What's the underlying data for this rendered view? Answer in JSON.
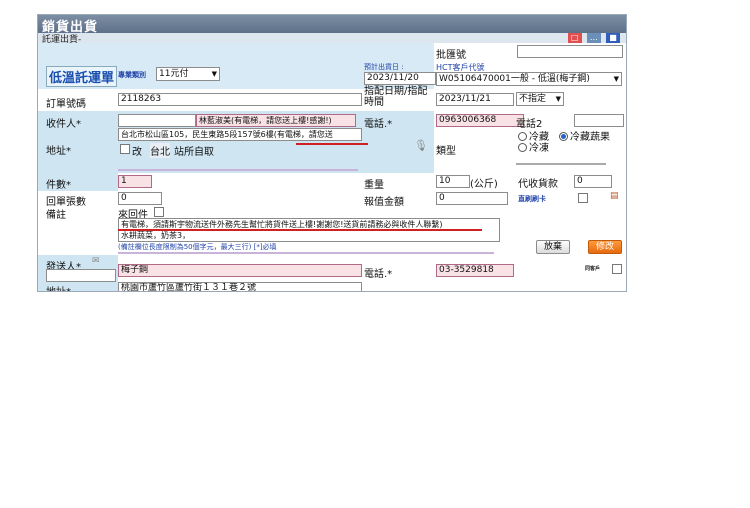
{
  "window": {
    "title": "銷貨出貨",
    "tab": "託運出貨-"
  },
  "header": {
    "batch_label": "批匯號",
    "batch_value": "",
    "service_title": "低溫託運單",
    "delivery_type_label": "專業類別",
    "delivery_type_value": "11元付",
    "ship_date_label": "預計出貨日 :",
    "ship_date_value": "2023/11/20",
    "hct_label": "HCT客戶代號",
    "hct_value": "W05106470001一般 - 低溫(梅子鋼)"
  },
  "order": {
    "order_no_label": "訂單號碼",
    "order_no_value": "2118263",
    "assign_label": "指配日期/指配時間",
    "assign_date": "2023/11/21",
    "assign_time": "不指定"
  },
  "recipient": {
    "name_label": "收件人*",
    "name_value": "",
    "name_note": "林藍淑美(有電梯，請您送上樓!感謝!)",
    "phone_label": "電話.*",
    "phone_value": "0963006368",
    "phone2_label": "電話2",
    "phone2_value": "",
    "address_label": "地址*",
    "address_value": "台北市松山區105，民生東路5段157號6樓(有電梯，請您送",
    "change_label": "改",
    "pickup_city": "台北",
    "pickup_label": "站所自取",
    "type_label": "類型",
    "temp_option_1": "冷藏",
    "temp_option_2": "冷藏蔬果",
    "temp_option_3": "冷凍"
  },
  "package": {
    "count_label": "件數*",
    "count_value": "1",
    "weight_label": "重量",
    "weight_value": "10",
    "weight_unit": "(公斤)",
    "cod_label": "代收貨款",
    "cod_value": "0",
    "return_label": "回單張數",
    "return_value": "0",
    "declared_label": "報值金額",
    "declared_value": "0",
    "print_label": "直刷刷卡"
  },
  "remarks": {
    "label": "備註",
    "return_item_label": "來回件",
    "line1": "有電梯，須請斯宇物流送件外務先生幫忙將貨件送上樓!謝謝您!送貨前請務必與收件人聯繫)",
    "line2": "水耕蔬菜，奶茶3，",
    "hint": "(備註欄位長度限制為50個字元，最大三行) [*]必填",
    "release_button": "放棄",
    "modify_button": "修改"
  },
  "sender": {
    "label": "發送人*",
    "name_value": "梅子鋼",
    "phone_label": "電話.*",
    "phone_value": "03-3529818",
    "sync_label": "同客戶",
    "address_label": "地址*",
    "address_value": "桃園市蘆竹區蘆竹街１３１巷２號"
  }
}
